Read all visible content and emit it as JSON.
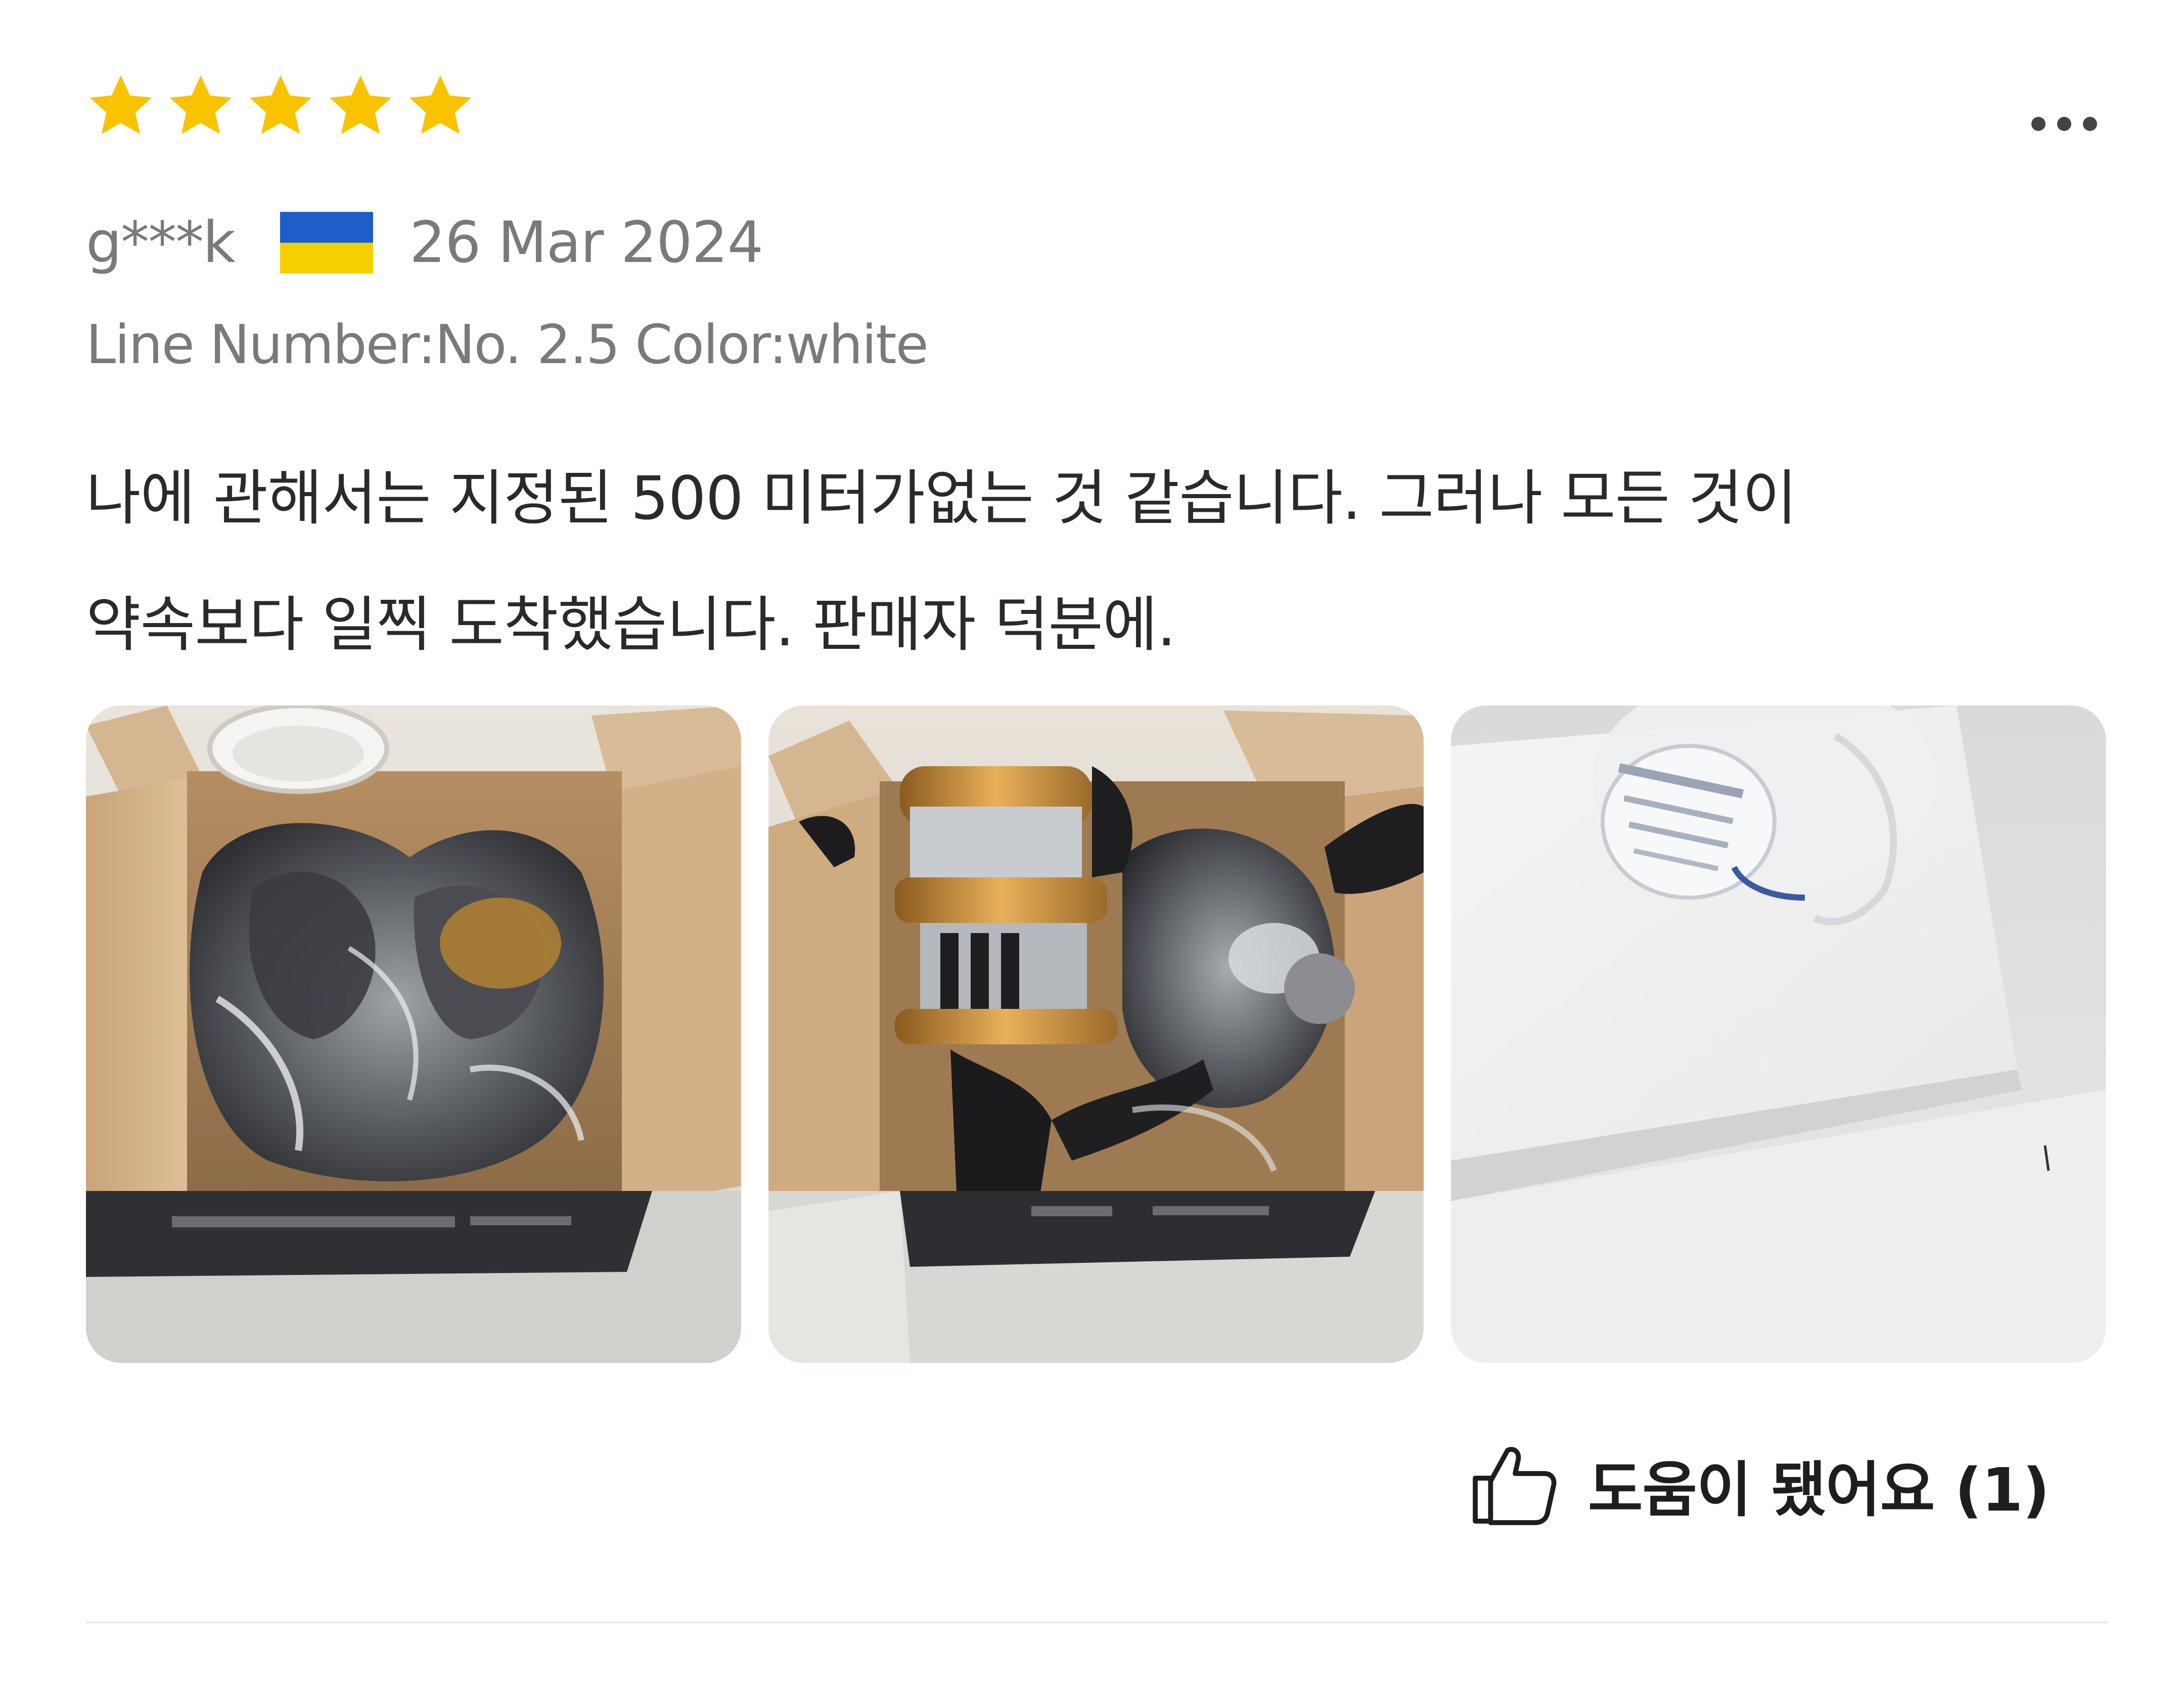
{
  "review": {
    "rating": 5,
    "rating_max": 5,
    "star_color": "#f9c300",
    "more_icon": "more-horizontal-icon",
    "username": "g***k",
    "country_flag": "ukraine-flag-icon",
    "date": "26 Mar 2024",
    "variant": "Line Number:No. 2.5 Color:white",
    "text_line_1": "나에 관해서는 지정된 500 미터가없는 것 같습니다. 그러나 모든 것이",
    "text_line_2": "약속보다 일찍 도착했습니다. 판매자 덕분에.",
    "photos": [
      {
        "icon": "photo-reel-box-wrapped"
      },
      {
        "icon": "photo-reel-unwrapped"
      },
      {
        "icon": "photo-fishing-line-spool"
      }
    ],
    "helpful": {
      "icon": "thumbs-up-icon",
      "label": "도움이 됐어요 (1)"
    }
  }
}
